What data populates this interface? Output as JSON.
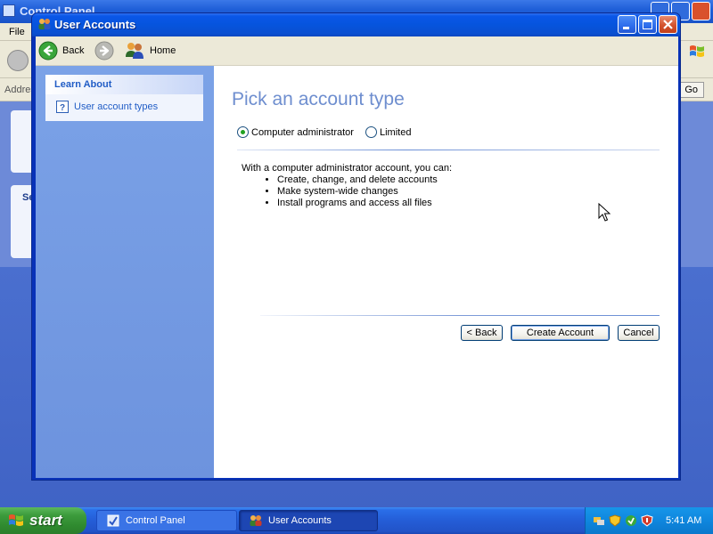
{
  "background_window": {
    "title": "Control Panel",
    "menu_first": "File",
    "address_label": "Address",
    "go_label": "Go",
    "panel_heading_partial": "Se"
  },
  "window": {
    "title": "User Accounts"
  },
  "toolbar": {
    "back_label": "Back",
    "home_label": "Home"
  },
  "sidebar": {
    "learn_header": "Learn About",
    "learn_link": "User account types"
  },
  "main": {
    "title": "Pick an account type",
    "options": [
      {
        "label": "Computer administrator",
        "selected": true
      },
      {
        "label": "Limited",
        "selected": false
      }
    ],
    "description": "With a computer administrator account, you can:",
    "features": [
      "Create, change, and delete accounts",
      "Make system-wide changes",
      "Install programs and access all files"
    ],
    "buttons": {
      "back": "< Back",
      "create": "Create Account",
      "cancel": "Cancel"
    }
  },
  "taskbar": {
    "start_label": "start",
    "items": [
      {
        "label": "Control Panel",
        "active": false
      },
      {
        "label": "User Accounts",
        "active": true
      }
    ],
    "clock": "5:41 AM"
  },
  "colors": {
    "title_accent": "#6e8ecf",
    "link": "#215dc6",
    "titlebar": "#0654dd",
    "start_green": "#3c9b3c"
  },
  "icons": {
    "back": "back-arrow-icon",
    "forward": "forward-arrow-icon",
    "home": "users-home-icon",
    "help": "question-mark-icon",
    "windows": "windows-flag-icon"
  }
}
